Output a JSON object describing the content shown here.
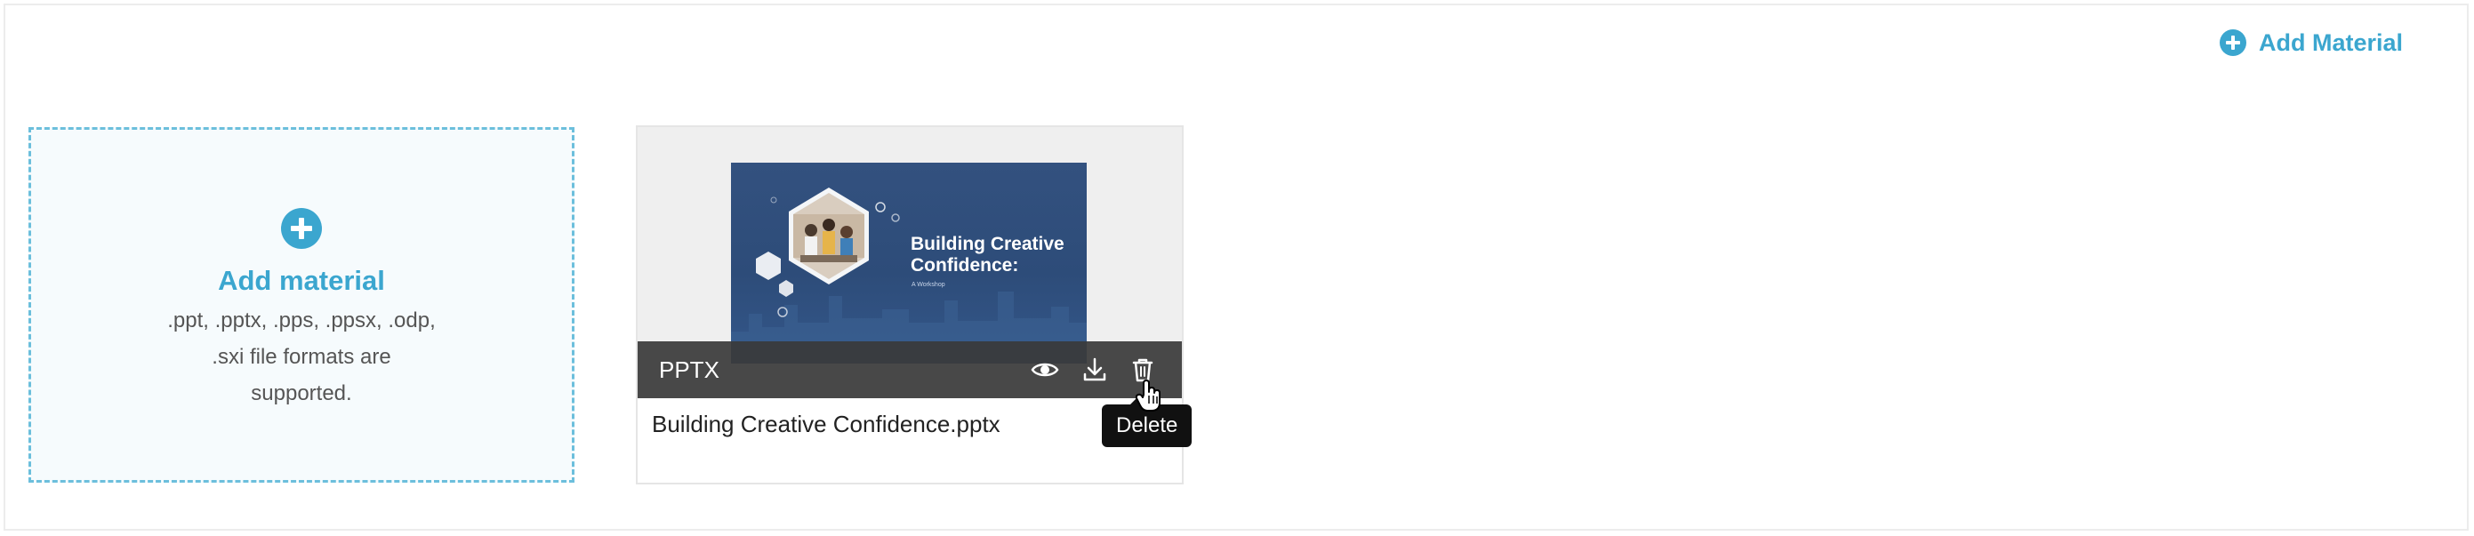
{
  "header": {
    "add_material_label": "Add Material",
    "icon": "plus-circle-icon"
  },
  "dropzone": {
    "title": "Add material",
    "description": ".ppt, .pptx, .pps, .ppsx, .odp, .sxi file formats are supported.",
    "icon": "plus-circle-icon"
  },
  "material": {
    "type_label": "PPTX",
    "file_name": "Building Creative Confidence.pptx",
    "thumbnail": {
      "title": "Building Creative Confidence:",
      "subtitle": "A Workshop"
    },
    "actions": [
      "view-icon",
      "download-icon",
      "delete-icon"
    ],
    "tooltip": "Delete"
  },
  "colors": {
    "accent": "#3ba6cf",
    "dropzone_border": "#6cbfdc",
    "toolbar": "#3a3a3a",
    "slide_bg": "#2d4c79"
  }
}
